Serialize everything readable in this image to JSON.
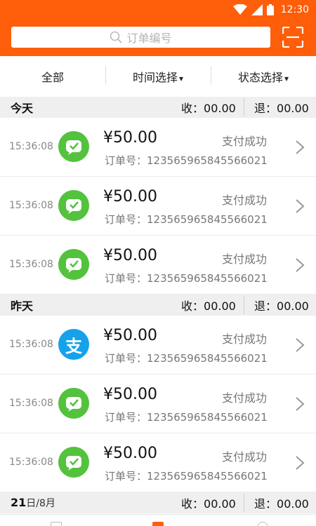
{
  "status_bar": {
    "time": "12:30"
  },
  "search": {
    "placeholder": "订单编号"
  },
  "filters": {
    "all": "全部",
    "time_select": "时间选择",
    "status_select": "状态选择",
    "caret": "▾"
  },
  "labels": {
    "received_prefix": "收：",
    "refund_prefix": "退：",
    "order_prefix": "订单号："
  },
  "sections": [
    {
      "title": "今天",
      "received": "00.00",
      "refund": "00.00"
    },
    {
      "title": "昨天",
      "received": "00.00",
      "refund": "00.00"
    },
    {
      "title_day": "21",
      "title_rest": "日/8月",
      "received": "00.00",
      "refund": "00.00"
    }
  ],
  "orders": [
    {
      "time": "15:36:08",
      "method_icon": "wechat-pay-icon",
      "amount": "¥50.00",
      "status": "支付成功",
      "order_no": "123565965845566021"
    },
    {
      "time": "15:36:08",
      "method_icon": "wechat-pay-icon",
      "amount": "¥50.00",
      "status": "支付成功",
      "order_no": "123565965845566021"
    },
    {
      "time": "15:36:08",
      "method_icon": "wechat-pay-icon",
      "amount": "¥50.00",
      "status": "支付成功",
      "order_no": "123565965845566021"
    },
    {
      "time": "15:36:08",
      "method_icon": "alipay-icon",
      "amount": "¥50.00",
      "status": "支付成功",
      "order_no": "123565965845566021",
      "alipay_glyph": "支"
    },
    {
      "time": "15:36:08",
      "method_icon": "wechat-pay-icon",
      "amount": "¥50.00",
      "status": "支付成功",
      "order_no": "123565965845566021"
    },
    {
      "time": "15:36:08",
      "method_icon": "wechat-pay-icon",
      "amount": "¥50.00",
      "status": "支付成功",
      "order_no": "123565965845566021"
    }
  ],
  "colors": {
    "brand_orange": "#fe5e09",
    "wechat_green": "#53c23d",
    "alipay_blue": "#15a2ea",
    "section_bg": "#efefef"
  }
}
